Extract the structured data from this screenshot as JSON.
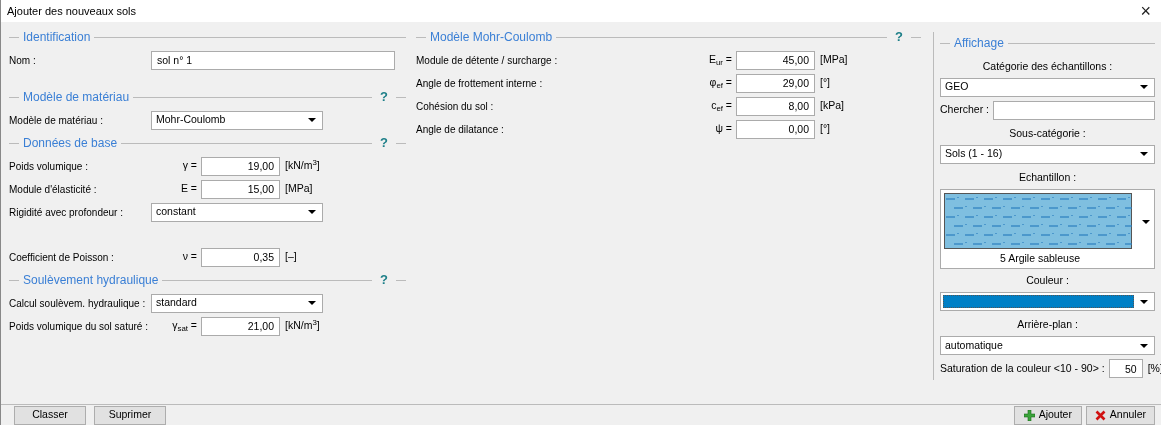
{
  "window": {
    "title": "Ajouter des nouveaux sols",
    "close": "×"
  },
  "left_sections": [
    {
      "title": "Identification",
      "rows": [
        {
          "kind": "text",
          "label": "Nom :",
          "value": "sol n° 1"
        }
      ]
    },
    {
      "title": "Modèle de matériau",
      "help": "?",
      "rows": [
        {
          "kind": "select",
          "label": "Modèle de matériau :",
          "value": "Mohr-Coulomb"
        }
      ]
    },
    {
      "title": "Données de base",
      "help": "?",
      "rows": [
        {
          "kind": "number",
          "label": "Poids volumique :",
          "symbol": "γ =",
          "value": "19,00",
          "unit": "[kN/m$^{3}$]"
        },
        {
          "kind": "number",
          "label": "Module d'élasticité :",
          "symbol": "E =",
          "value": "15,00",
          "unit": "[MPa]"
        },
        {
          "kind": "select",
          "label": "Rigidité avec profondeur :",
          "value": "constant"
        },
        {
          "kind": "number",
          "label": "Coefficient de Poisson :",
          "symbol": "ν =",
          "value": "0,35",
          "unit": "[–]"
        }
      ]
    },
    {
      "title": "Soulèvement hydraulique",
      "help": "?",
      "rows": [
        {
          "kind": "select",
          "label": "Calcul soulèvem. hydraulique :",
          "value": "standard"
        },
        {
          "kind": "number",
          "label": "Poids volumique du sol saturé :",
          "symbol": "γ$_{sat}$ =",
          "value": "21,00",
          "unit": "[kN/m$^{3}$]"
        }
      ]
    }
  ],
  "middle_section": {
    "title": "Modèle Mohr-Coulomb",
    "help": "?",
    "rows": [
      {
        "kind": "number",
        "label": "Module de détente / surcharge :",
        "symbol": "E$_{ur}$ =",
        "value": "45,00",
        "unit": "[MPa]"
      },
      {
        "kind": "number",
        "label": "Angle de frottement interne :",
        "symbol": "φ$_{ef}$ =",
        "value": "29,00",
        "unit": "[°]"
      },
      {
        "kind": "number",
        "label": "Cohésion du sol :",
        "symbol": "c$_{ef}$ =",
        "value": "8,00",
        "unit": "[kPa]"
      },
      {
        "kind": "number",
        "label": "Angle de dilatance :",
        "symbol": "ψ =",
        "value": "0,00",
        "unit": "[°]"
      }
    ]
  },
  "display_panel": {
    "title": "Affichage",
    "items": [
      {
        "kind": "caption",
        "text": "Catégorie des échantillons :"
      },
      {
        "kind": "select",
        "value": "GEO"
      },
      {
        "kind": "search",
        "label": "Chercher :"
      },
      {
        "kind": "caption",
        "text": "Sous-catégorie :"
      },
      {
        "kind": "select",
        "value": "Sols (1 - 16)"
      },
      {
        "kind": "caption",
        "text": "Echantillon :"
      },
      {
        "kind": "sample",
        "name": "5 Argile sableuse"
      },
      {
        "kind": "caption",
        "text": "Couleur :"
      },
      {
        "kind": "color",
        "color": "#0080c6"
      },
      {
        "kind": "caption",
        "text": "Arrière-plan :"
      },
      {
        "kind": "select",
        "value": "automatique"
      },
      {
        "kind": "number",
        "label": "Saturation de la couleur <10 - 90> :",
        "value": "50",
        "unit": "[%]"
      }
    ]
  },
  "footer": {
    "left_buttons": [
      "Classer",
      "Suprimer"
    ],
    "right_buttons": [
      {
        "kind": "add",
        "label": "Ajouter"
      },
      {
        "kind": "cancel",
        "label": "Annuler"
      }
    ]
  }
}
